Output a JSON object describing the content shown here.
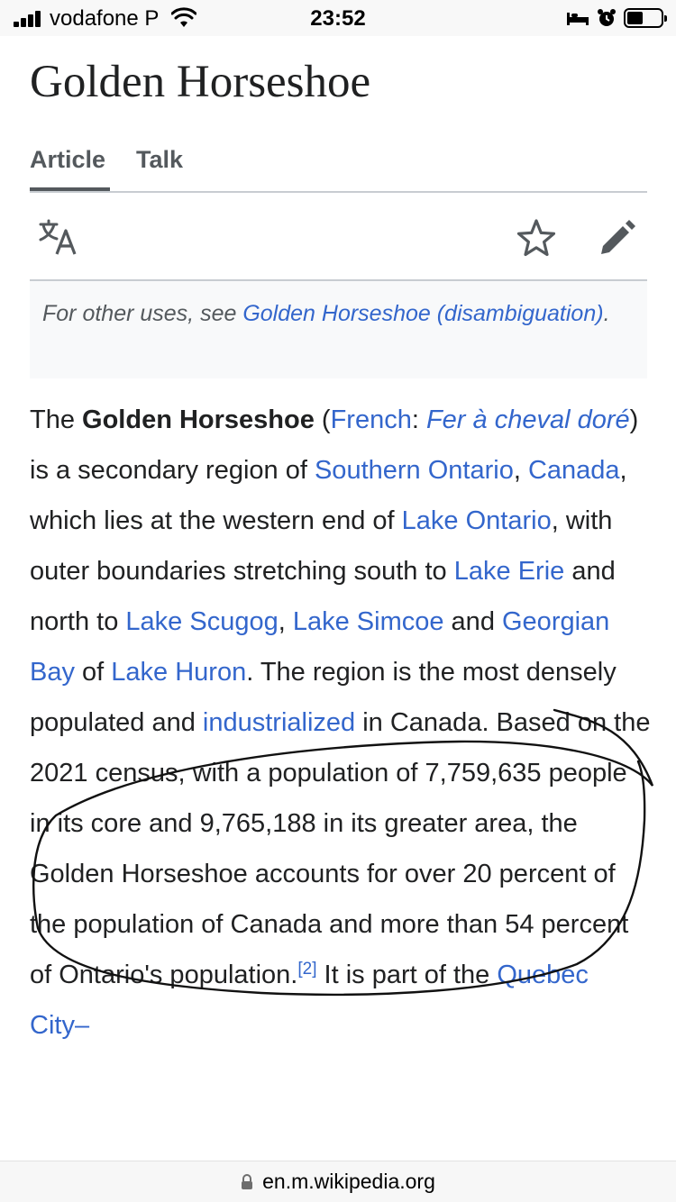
{
  "status_bar": {
    "carrier": "vodafone P",
    "time": "23:52",
    "icons": [
      "signal-icon",
      "wifi-icon",
      "bed-icon",
      "alarm-icon",
      "battery-icon"
    ]
  },
  "page": {
    "title": "Golden Horseshoe",
    "tabs": [
      {
        "label": "Article",
        "selected": true
      },
      {
        "label": "Talk",
        "selected": false
      }
    ],
    "actions": [
      "language-icon",
      "watch-star-icon",
      "edit-pencil-icon"
    ]
  },
  "hatnote": {
    "prefix": "For other uses, see ",
    "link_text": "Golden Horseshoe (disambiguation)",
    "suffix": "."
  },
  "article": {
    "s1": "The ",
    "bold_title": "Golden Horseshoe",
    "s2": " (",
    "link_french": "French",
    "s3": ": ",
    "french_name": "Fer à cheval doré",
    "s4": ") is a secondary region of ",
    "link_southern_ontario": "Southern Ontario",
    "s5": ", ",
    "link_canada": "Canada",
    "s6": ", which lies at the western end of ",
    "link_lake_ontario": "Lake Ontario",
    "s7": ", with outer boundaries stretching south to ",
    "link_lake_erie": "Lake Erie",
    "s8": " and north to ",
    "link_lake_scugog": "Lake Scugog",
    "s9": ", ",
    "link_lake_simcoe": "Lake Simcoe",
    "s10": " and ",
    "link_georgian_bay": "Georgian Bay",
    "s11": " of ",
    "link_lake_huron": "Lake Huron",
    "s12": ". The region is the most densely populated and ",
    "link_industrialized": "industrialized",
    "s13": " in Canada. Based on the 2021 census, with a population of 7,759,635 people in its core and 9,765,188 in its greater area, the Golden Horseshoe accounts for over 20 percent of the population of Canada and more than 54 percent of Ontario's population.",
    "citation": "[2]",
    "s14": " It is part of the ",
    "link_quebec": "Quebec City–"
  },
  "url_bar": {
    "url": "en.m.wikipedia.org"
  },
  "colors": {
    "link": "#3366cc",
    "text": "#202122",
    "muted": "#54595d",
    "border": "#c8ccd1",
    "hatnote_bg": "#f8f9fa"
  }
}
